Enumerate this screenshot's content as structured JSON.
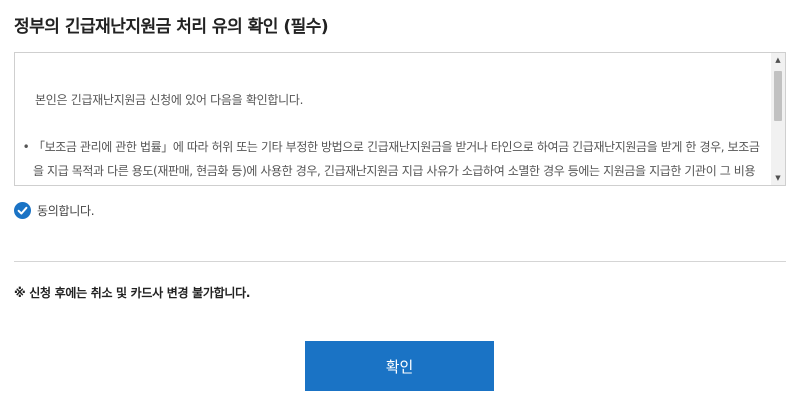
{
  "title": "정부의 긴급재난지원금 처리 유의 확인 (필수)",
  "terms": {
    "intro": "본인은 긴급재난지원금 신청에 있어 다음을 확인합니다.",
    "items": [
      {
        "bullet": "•",
        "text": "「보조금 관리에 관한 법률」에 따라 허위 또는 기타 부정한 방법으로 긴급재난지원금을 받거나 타인으로 하여금 긴급재난지원금을 받게 한 경우, 보조금을 지급 목적과 다른 용도(재판매, 현금화 등)에 사용한 경우, 긴급재난지원금 지급 사유가 소급하여 소멸한 경우 등에는 지원금을 지급한 기관이 그 비용의 전"
      }
    ],
    "scroll_up_glyph": "▲",
    "scroll_down_glyph": "▼"
  },
  "agree": {
    "label": "동의합니다.",
    "checked": true,
    "icon": "check-circle-icon",
    "icon_color": "#1a73c5"
  },
  "notice": "※ 신청 후에는 취소 및 카드사 변경 불가합니다.",
  "confirm_button": {
    "label": "확인",
    "color": "#1a73c5"
  }
}
